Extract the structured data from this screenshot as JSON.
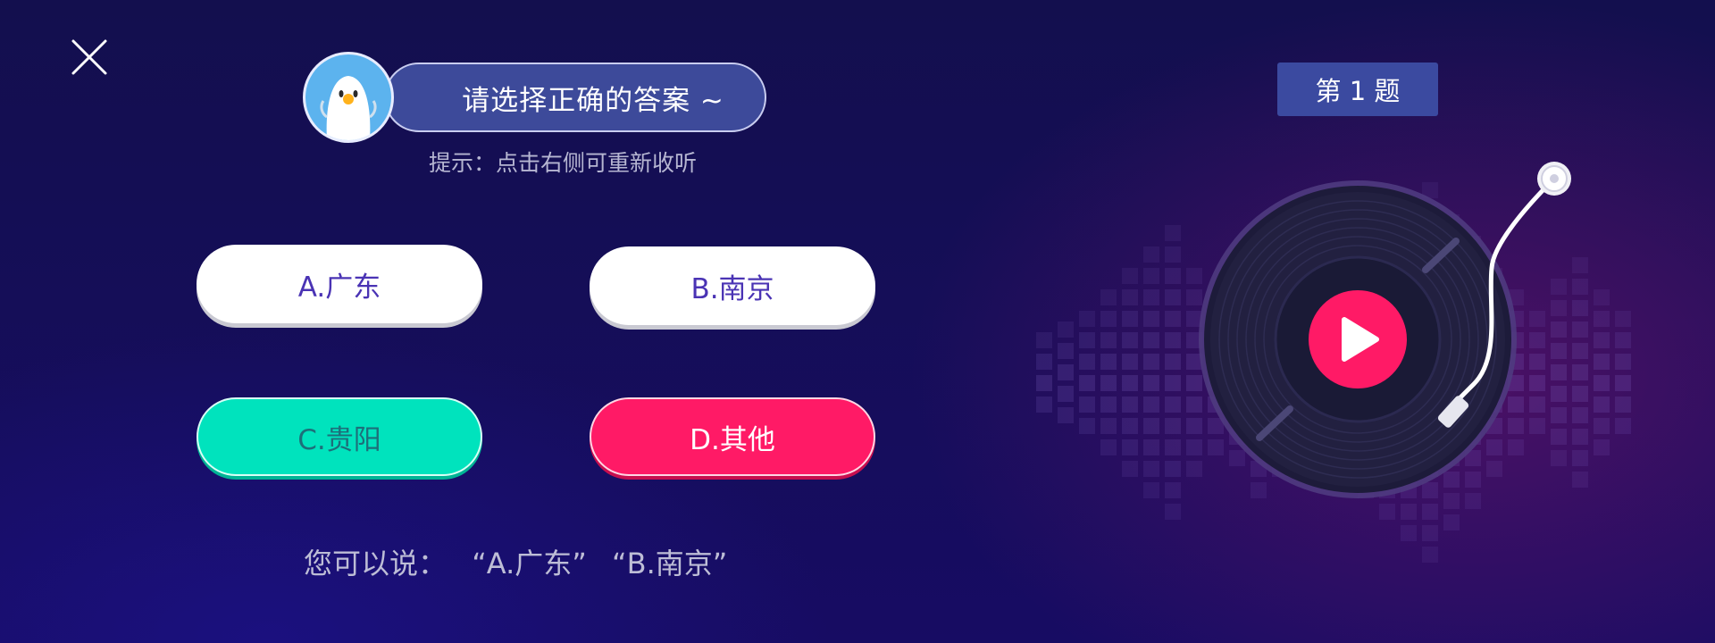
{
  "prompt": {
    "title": "请选择正确的答案 ~",
    "hint": "提示：点击右侧可重新收听"
  },
  "options": [
    {
      "label": "A.广东"
    },
    {
      "label": "B.南京"
    },
    {
      "label": "C.贵阳"
    },
    {
      "label": "D.其他"
    }
  ],
  "voice": {
    "prefix": "您可以说：",
    "examples": [
      "“A.广东”",
      "“B.南京”"
    ]
  },
  "question_badge": "第 1 题",
  "icons": {
    "close": "close-icon",
    "mascot": "mascot-avatar",
    "play": "play-icon",
    "record": "vinyl-record-icon"
  },
  "colors": {
    "background": "#150e5a",
    "pill": "#3d4a9a",
    "correct_option": "#00e3bd",
    "wrong_option": "#ff1a66",
    "option_text": "#4a33b4",
    "badge": "#3b4aa0",
    "play_button": "#ff1a66"
  }
}
